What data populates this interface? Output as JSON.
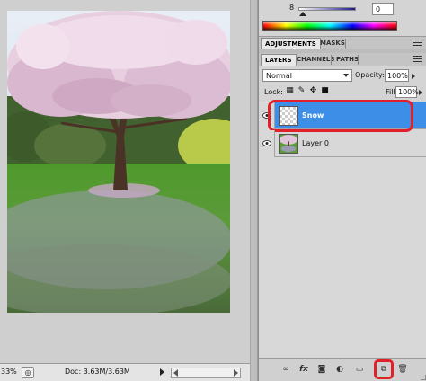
{
  "status": {
    "zoom": "33%",
    "doc": "Doc: 3.63M/3.63M"
  },
  "color_panel": {
    "slider_tick": "8",
    "slider_value": "0"
  },
  "adjust_tabs": [
    "ADJUSTMENTS",
    "MASKS"
  ],
  "layers_tabs": [
    "LAYERS",
    "CHANNELS",
    "PATHS"
  ],
  "layers_panel": {
    "blend_mode": "Normal",
    "opacity_label": "Opacity:",
    "opacity_value": "100%",
    "lock_label": "Lock:",
    "fill_label": "Fill:",
    "fill_value": "100%"
  },
  "layers": [
    {
      "name": "Snow",
      "selected": true,
      "visible": true
    },
    {
      "name": "Layer 0",
      "selected": false,
      "visible": true
    }
  ],
  "colors": {
    "selection": "#3d8ee6",
    "highlight_ring": "#e0202a"
  },
  "icons": {
    "lock": [
      "lock-transparency-icon",
      "lock-image-icon",
      "lock-position-icon",
      "lock-all-icon"
    ],
    "bottom": [
      "link-layers-icon",
      "layer-style-icon",
      "add-mask-icon",
      "adjustment-layer-icon",
      "new-group-icon",
      "new-layer-icon",
      "delete-layer-icon"
    ]
  }
}
